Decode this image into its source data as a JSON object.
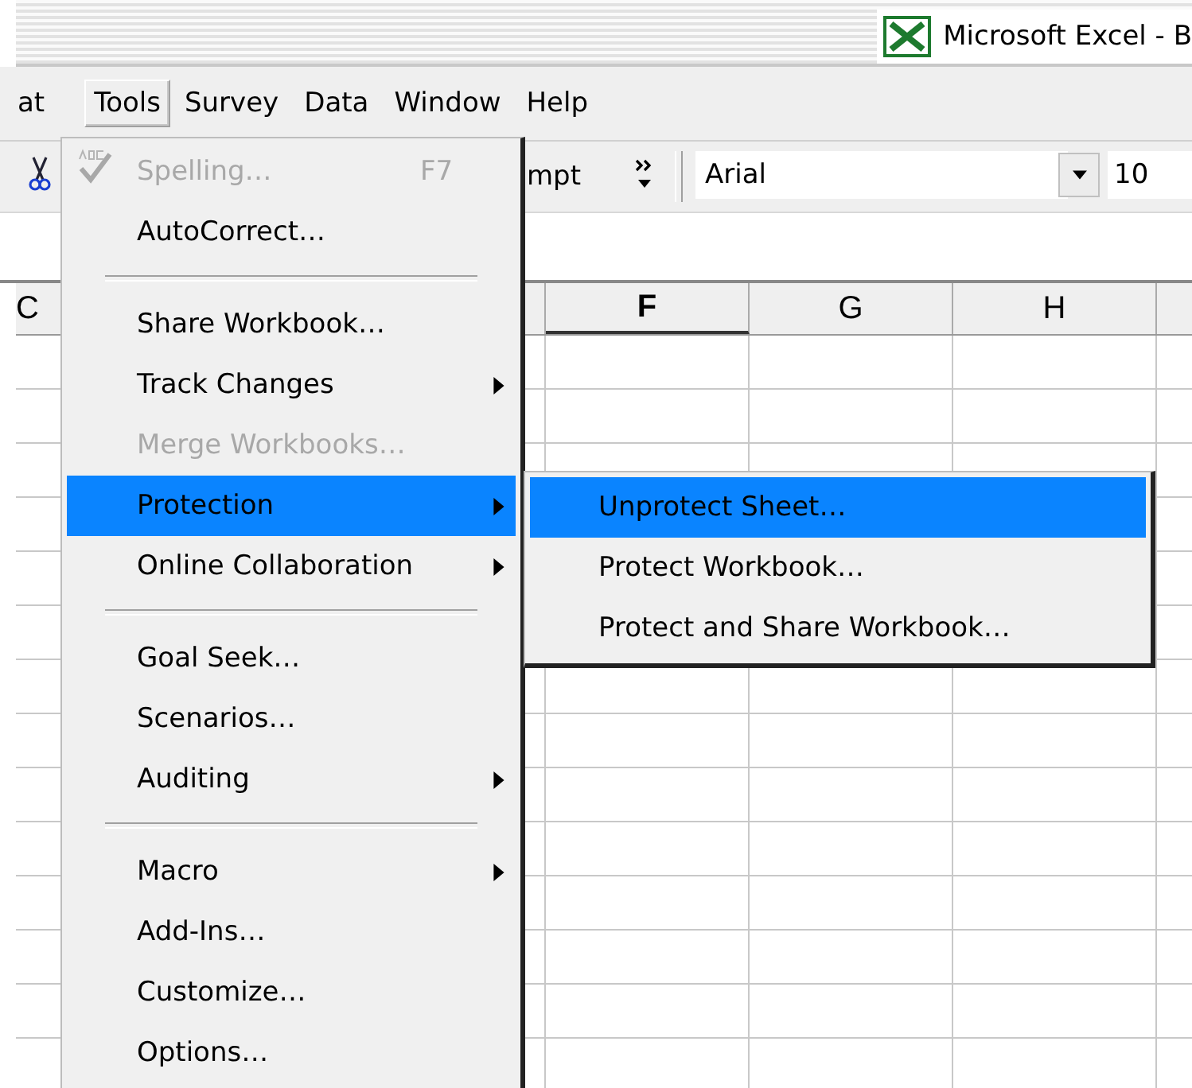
{
  "window": {
    "title": "Microsoft Excel - B"
  },
  "menu_bar": [
    {
      "label": "at",
      "selected": false
    },
    {
      "label": "Tools",
      "selected": true
    },
    {
      "label": "Survey",
      "selected": false
    },
    {
      "label": "Data",
      "selected": false
    },
    {
      "label": "Window",
      "selected": false
    },
    {
      "label": "Help",
      "selected": false
    }
  ],
  "toolbar": {
    "partial_text": "mpt",
    "font": "Arial",
    "font_size": "10"
  },
  "columns": [
    "C",
    "F",
    "G",
    "H"
  ],
  "tools_menu": [
    {
      "kind": "item",
      "label": "Spelling…",
      "shortcut": "F7",
      "has_icon": true,
      "disabled": true,
      "submenu": false,
      "selected": false
    },
    {
      "kind": "item",
      "label": "AutoCorrect…",
      "has_icon": false,
      "disabled": false,
      "submenu": false,
      "selected": false
    },
    {
      "kind": "separator"
    },
    {
      "kind": "item",
      "label": "Share Workbook…",
      "has_icon": false,
      "disabled": false,
      "submenu": false,
      "selected": false
    },
    {
      "kind": "item",
      "label": "Track Changes",
      "has_icon": false,
      "disabled": false,
      "submenu": true,
      "selected": false
    },
    {
      "kind": "item",
      "label": "Merge Workbooks…",
      "has_icon": false,
      "disabled": true,
      "submenu": false,
      "selected": false
    },
    {
      "kind": "item",
      "label": "Protection",
      "has_icon": false,
      "disabled": false,
      "submenu": true,
      "selected": true
    },
    {
      "kind": "item",
      "label": "Online Collaboration",
      "has_icon": false,
      "disabled": false,
      "submenu": true,
      "selected": false
    },
    {
      "kind": "separator"
    },
    {
      "kind": "item",
      "label": "Goal Seek…",
      "has_icon": false,
      "disabled": false,
      "submenu": false,
      "selected": false
    },
    {
      "kind": "item",
      "label": "Scenarios…",
      "has_icon": false,
      "disabled": false,
      "submenu": false,
      "selected": false
    },
    {
      "kind": "item",
      "label": "Auditing",
      "has_icon": false,
      "disabled": false,
      "submenu": true,
      "selected": false
    },
    {
      "kind": "separator"
    },
    {
      "kind": "item",
      "label": "Macro",
      "has_icon": false,
      "disabled": false,
      "submenu": true,
      "selected": false
    },
    {
      "kind": "item",
      "label": "Add-Ins…",
      "has_icon": false,
      "disabled": false,
      "submenu": false,
      "selected": false
    },
    {
      "kind": "item",
      "label": "Customize…",
      "has_icon": false,
      "disabled": false,
      "submenu": false,
      "selected": false
    },
    {
      "kind": "item",
      "label": "Options…",
      "has_icon": false,
      "disabled": false,
      "submenu": false,
      "selected": false
    }
  ],
  "protection_submenu": [
    {
      "label": "Unprotect Sheet…",
      "selected": true
    },
    {
      "label": "Protect Workbook…",
      "selected": false
    },
    {
      "label": "Protect and Share Workbook…",
      "selected": false
    }
  ]
}
